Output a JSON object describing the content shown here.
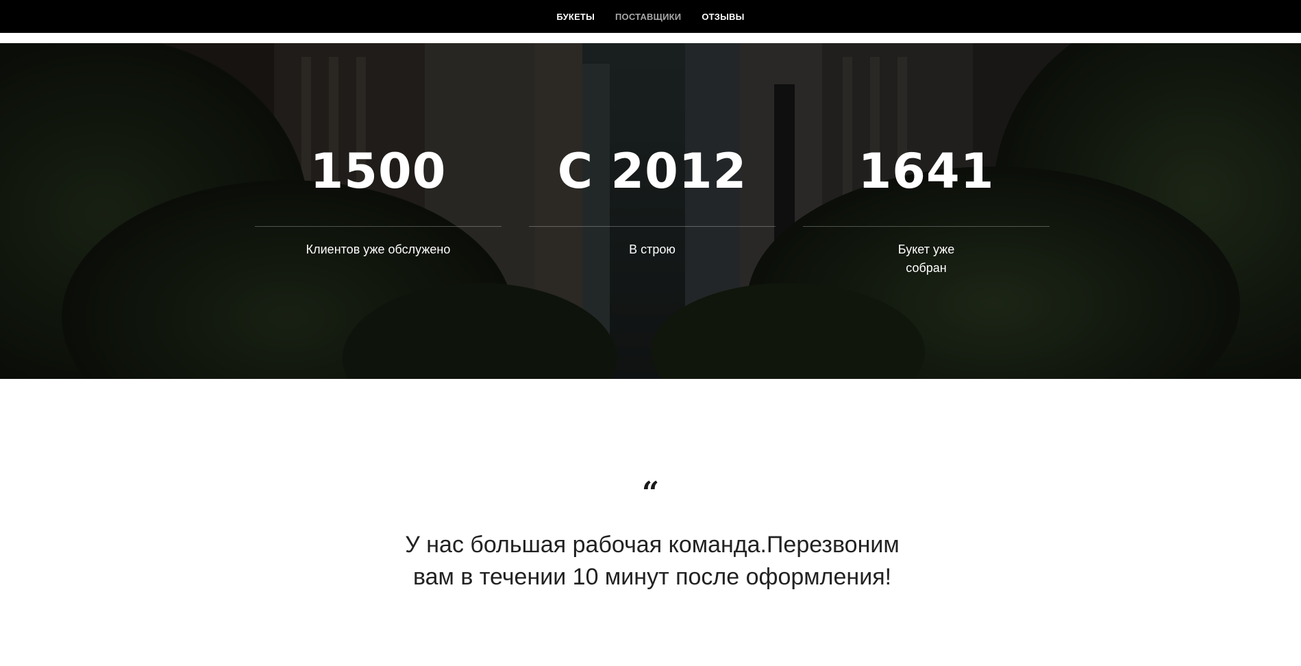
{
  "nav": {
    "items": [
      {
        "label": "БУКЕТЫ"
      },
      {
        "label": "ПОСТАВЩИКИ"
      },
      {
        "label": "ОТЗЫВЫ"
      }
    ]
  },
  "stats": [
    {
      "value": "1500",
      "caption": "Клиентов уже обслужено"
    },
    {
      "value": "С 2012",
      "caption": "В строю"
    },
    {
      "value": "1641",
      "caption": "Букет уже собран"
    }
  ],
  "quote": {
    "mark": "“",
    "text": "У нас большая рабочая команда.Перезвоним вам в течении 10 минут после оформления!"
  },
  "colors": {
    "topbar": "#000000",
    "nav_active": "#ffffff",
    "nav_dim": "#a7a7a7",
    "hero_overlay": "#12150f",
    "quote_text": "#222222"
  }
}
